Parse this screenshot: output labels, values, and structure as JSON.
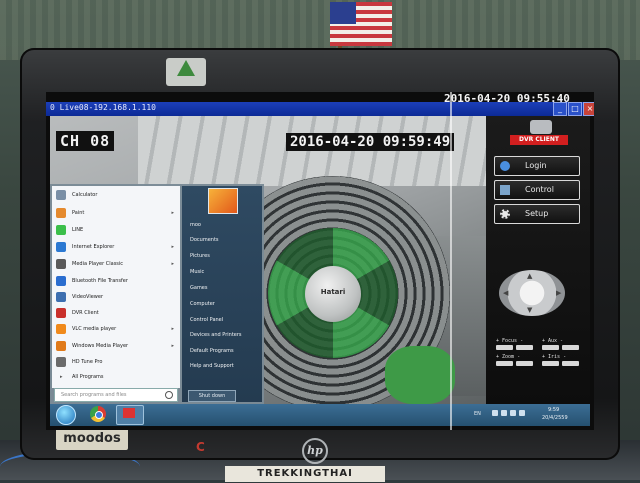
{
  "colors": {
    "titlebar": "#0c2a96",
    "taskbar": "#25506f",
    "accent_red": "#d21f1f",
    "startmenu_right": "#2f4a62"
  },
  "screen": {
    "window_title": "0 Live08-192.168.1.110",
    "window_buttons": [
      "_",
      "□",
      "×"
    ],
    "top_timestamp": "2016-04-20 09:55:40"
  },
  "video": {
    "channel_label": "CH 08",
    "timestamp": "2016-04-20 09:59:49",
    "fan_brand": "Hatari"
  },
  "panel": {
    "logo_text": "DVR CLIENT",
    "buttons": [
      {
        "label": "Login",
        "icon": "user-icon"
      },
      {
        "label": "Control",
        "icon": "monitor-icon"
      },
      {
        "label": "Setup",
        "icon": "gear-icon"
      }
    ],
    "ptz_arrows": {
      "up": "▲",
      "down": "▼",
      "left": "◀",
      "right": "▶"
    },
    "controls": [
      "+ Focus -",
      "+ Aux -",
      "+ Zoom -",
      "+ Iris -"
    ]
  },
  "start_menu": {
    "left_items": [
      {
        "label": "Calculator",
        "icon": "calculator-icon",
        "color": "#7a8fa6",
        "has_arrow": false
      },
      {
        "label": "Paint",
        "icon": "paint-icon",
        "color": "#e58a2e",
        "has_arrow": true
      },
      {
        "label": "LINE",
        "icon": "line-icon",
        "color": "#3bbf4a",
        "has_arrow": false
      },
      {
        "label": "Internet Explorer",
        "icon": "ie-icon",
        "color": "#2c79d2",
        "has_arrow": true
      },
      {
        "label": "Media Player Classic",
        "icon": "media-player-icon",
        "color": "#5a5a5a",
        "has_arrow": true
      },
      {
        "label": "Bluetooth File Transfer",
        "icon": "bluetooth-icon",
        "color": "#2a6dcf",
        "has_arrow": false
      },
      {
        "label": "VideoViewer",
        "icon": "video-viewer-icon",
        "color": "#3d6fb0",
        "has_arrow": false
      },
      {
        "label": "DVR Client",
        "icon": "dvr-client-icon",
        "color": "#c9302c",
        "has_arrow": false
      },
      {
        "label": "VLC media player",
        "icon": "vlc-icon",
        "color": "#f08a1c",
        "has_arrow": true
      },
      {
        "label": "Windows Media Player",
        "icon": "wmp-icon",
        "color": "#e07a1a",
        "has_arrow": true
      },
      {
        "label": "HD Tune Pro",
        "icon": "hd-tune-icon",
        "color": "#6b6b6b",
        "has_arrow": false
      }
    ],
    "all_programs": "All Programs",
    "search_placeholder": "Search programs and files",
    "right_items": [
      "moo",
      "Documents",
      "Pictures",
      "Music",
      "Games",
      "Computer",
      "Control Panel",
      "Devices and Printers",
      "Default Programs",
      "Help and Support"
    ],
    "shutdown": "Shut down"
  },
  "taskbar": {
    "language": "EN",
    "time": "9:59",
    "date": "20/4/2559"
  },
  "monitor": {
    "brand_sticker": "moodos",
    "hp_logo": "hp",
    "sticker": "TREKKINGTHAI"
  }
}
